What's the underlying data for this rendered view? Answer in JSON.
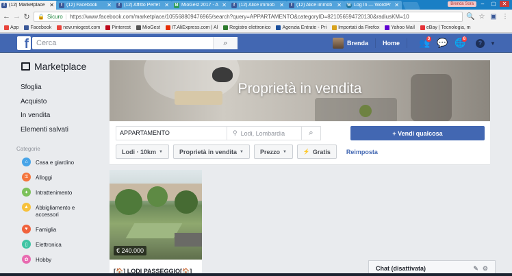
{
  "browser": {
    "tabs": [
      {
        "title": "(12) Marketplace",
        "active": true
      },
      {
        "title": "(12) Facebook",
        "active": false
      },
      {
        "title": "(12) Affitto Perfet",
        "active": false
      },
      {
        "title": "MioGest 2017 - A",
        "active": false
      },
      {
        "title": "(12) Alice immob",
        "active": false
      },
      {
        "title": "(12) Alice immob",
        "active": false
      },
      {
        "title": "Log In — WordPr",
        "active": false
      }
    ],
    "user_chip": "Brenda Sora",
    "secure_label": "Sicuro",
    "url": "https://www.facebook.com/marketplace/105568809476965/search?query=APPARTAMENTO&categoryID=821056594720130&radiusKM=10",
    "bookmarks": [
      {
        "label": "App",
        "color": "#e8453c"
      },
      {
        "label": "Facebook",
        "color": "#3b5998"
      },
      {
        "label": "new.miogest.com",
        "color": "#e8453c"
      },
      {
        "label": "Pinterest",
        "color": "#bd081c"
      },
      {
        "label": "MioGest",
        "color": "#555555"
      },
      {
        "label": "IT.AliExpress.com | Al",
        "color": "#e62e04"
      },
      {
        "label": "Registro elettronico",
        "color": "#2c7a2c"
      },
      {
        "label": "Agenzia Entrate - Pri",
        "color": "#1b4f9c"
      },
      {
        "label": "Importati da Firefox",
        "color": "#d8a31e"
      },
      {
        "label": "Yahoo Mail",
        "color": "#5f01d1"
      },
      {
        "label": "eBay | Tecnologia, m",
        "color": "#e53238"
      }
    ]
  },
  "header": {
    "search_placeholder": "Cerca",
    "user_name": "Brenda",
    "home_label": "Home",
    "friend_badge": "3",
    "notif_badge": "8",
    "brand_color": "#4267b2"
  },
  "sidebar": {
    "title": "Marketplace",
    "nav": [
      "Sfoglia",
      "Acquisto",
      "In vendita",
      "Elementi salvati"
    ],
    "categories_title": "Categorie",
    "categories": [
      {
        "label": "Casa e giardino",
        "color": "#47a4e8",
        "icon": "home-icon"
      },
      {
        "label": "Alloggi",
        "color": "#f4743b",
        "icon": "house-key-icon"
      },
      {
        "label": "Intrattenimento",
        "color": "#7cc15a",
        "icon": "gamepad-icon"
      },
      {
        "label": "Abbigliamento e accessori",
        "color": "#f7c13b",
        "icon": "shirt-icon"
      },
      {
        "label": "Famiglia",
        "color": "#f0623c",
        "icon": "heart-icon"
      },
      {
        "label": "Elettronica",
        "color": "#3ec4a3",
        "icon": "phone-icon"
      },
      {
        "label": "Hobby",
        "color": "#e86ab0",
        "icon": "hobby-icon"
      }
    ]
  },
  "banner": {
    "title": "Proprietà in vendita"
  },
  "filters": {
    "query": "APPARTAMENTO",
    "location_placeholder": "Lodi, Lombardia",
    "sell_label": "+ Vendi qualcosa",
    "chips": [
      "Lodi · 10km",
      "Proprietà in vendita",
      "Prezzo",
      "Gratis"
    ],
    "reset_label": "Reimposta"
  },
  "listings": [
    {
      "price": "€ 240.000",
      "title": "[🏠] LODI PASSEGGIO[🏠]"
    }
  ],
  "chat": {
    "label": "Chat (disattivata)"
  }
}
